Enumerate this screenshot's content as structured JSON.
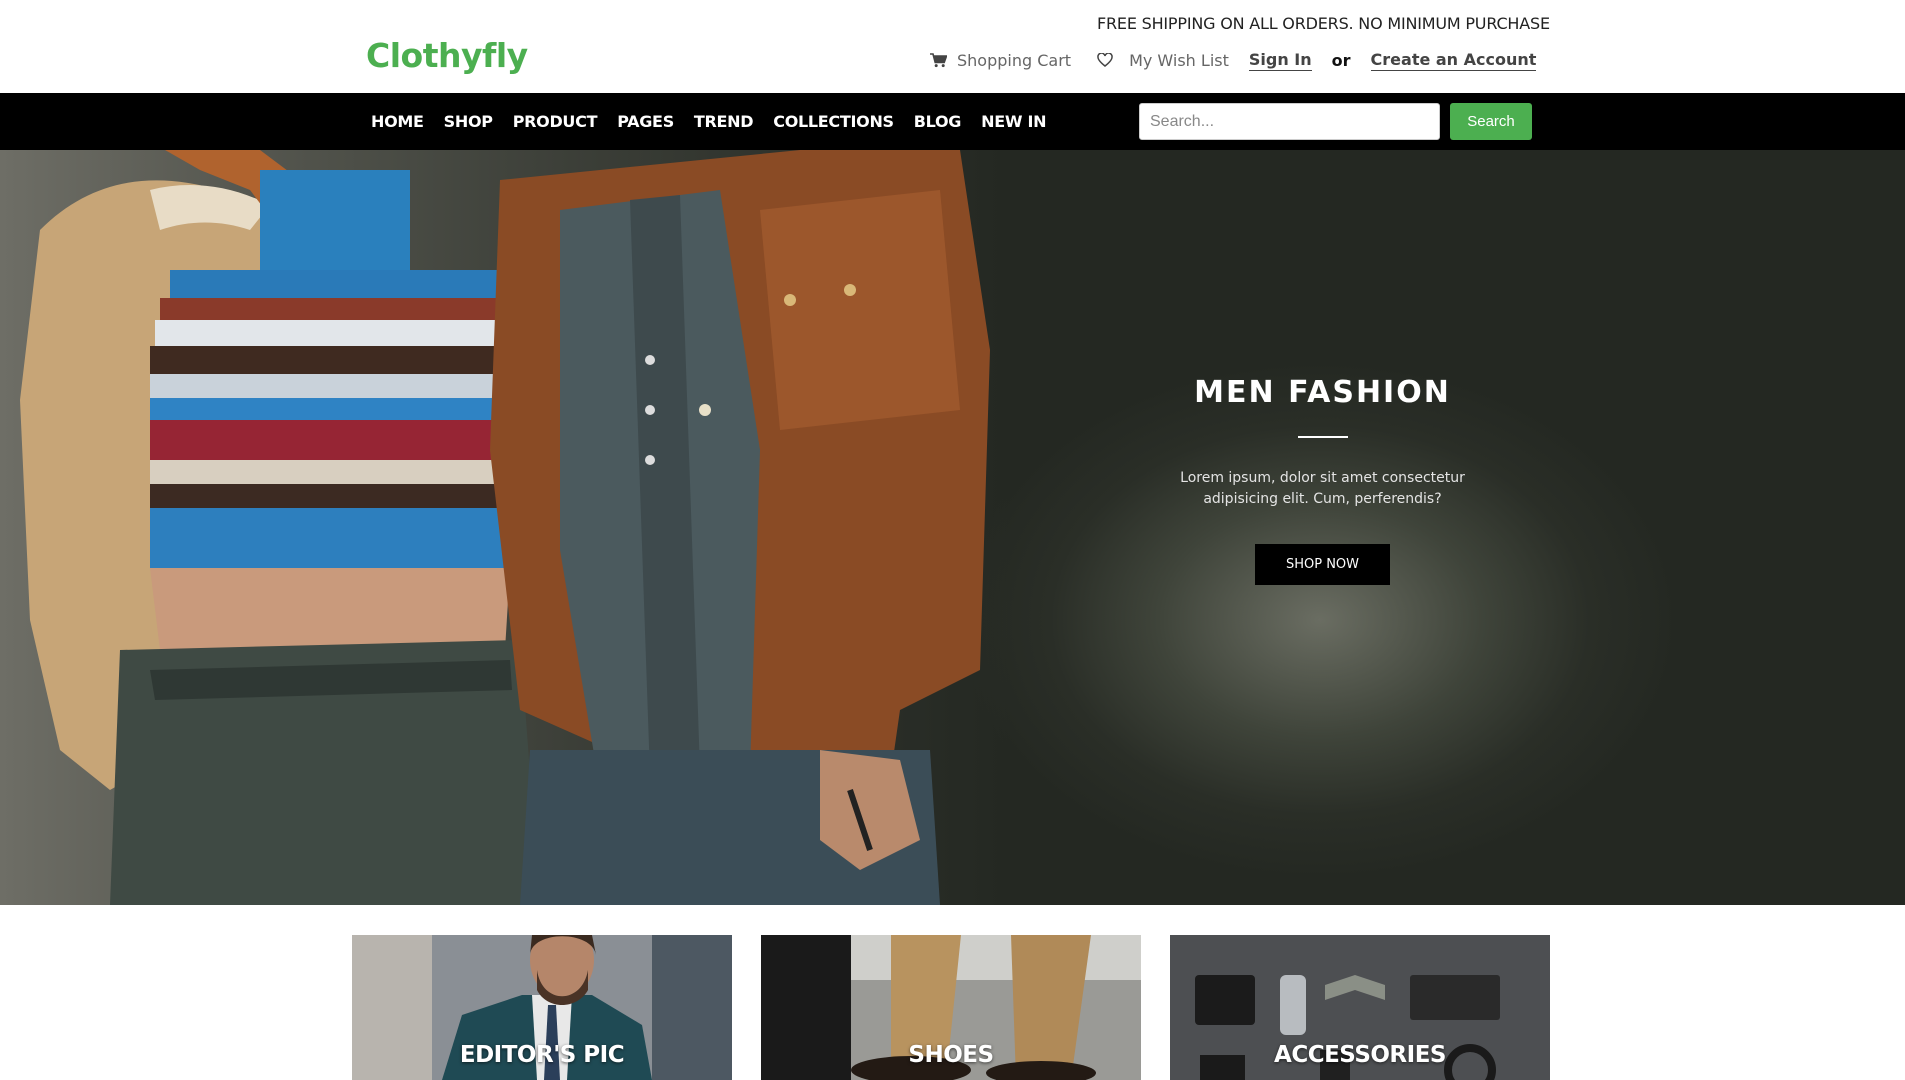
{
  "header": {
    "shipping_notice": "FREE SHIPPING ON ALL ORDERS. NO MINIMUM PURCHASE",
    "logo": "Clothyfly",
    "cart_label": "Shopping Cart",
    "cart_icon": "cart-icon",
    "wishlist_label": "My Wish List",
    "wishlist_icon": "heart-icon",
    "signin_label": "Sign In",
    "or_label": "or",
    "create_account_label": "Create an Account"
  },
  "nav": {
    "items": [
      "HOME",
      "SHOP",
      "PRODUCT",
      "PAGES",
      "TREND",
      "COLLECTIONS",
      "BLOG",
      "NEW IN"
    ],
    "search_placeholder": "Search...",
    "search_button": "Search"
  },
  "hero": {
    "title": "MEN FASHION",
    "description": "Lorem ipsum, dolor sit amet consectetur adipisicing elit. Cum, perferendis?",
    "button": "SHOP NOW"
  },
  "categories": [
    {
      "label": "EDITOR'S PIC"
    },
    {
      "label": "SHOES"
    },
    {
      "label": "ACCESSORIES"
    }
  ],
  "colors": {
    "brand_green": "#4caf50",
    "nav_background": "#000000",
    "button_dark": "#000000"
  }
}
